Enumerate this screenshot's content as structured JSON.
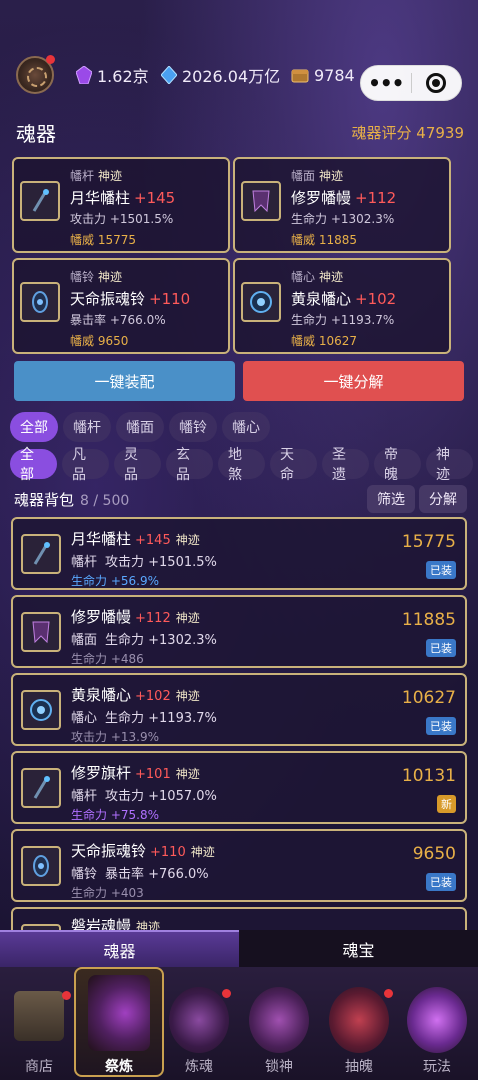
{
  "header": {
    "resources": [
      {
        "icon": "purple-crystal-icon",
        "value": "1.62京"
      },
      {
        "icon": "blue-diamond-icon",
        "value": "2026.04万亿"
      },
      {
        "icon": "gold-chest-icon",
        "value": "9784"
      }
    ]
  },
  "section": {
    "title": "魂器",
    "score_label": "魂器评分",
    "score_value": "47939"
  },
  "equipped": [
    {
      "slot": "幡杆",
      "rank": "神迹",
      "name": "月华幡柱",
      "plus": "+145",
      "stat": "攻击力 +1501.5%",
      "power": "幡威 15775",
      "icon": "staff-icon"
    },
    {
      "slot": "幡面",
      "rank": "神迹",
      "name": "修罗幡幔",
      "plus": "+112",
      "stat": "生命力 +1302.3%",
      "power": "幡威 11885",
      "icon": "banner-icon"
    },
    {
      "slot": "幡铃",
      "rank": "神迹",
      "name": "天命振魂铃",
      "plus": "+110",
      "stat": "暴击率 +766.0%",
      "power": "幡威 9650",
      "icon": "bell-icon"
    },
    {
      "slot": "幡心",
      "rank": "神迹",
      "name": "黄泉幡心",
      "plus": "+102",
      "stat": "生命力 +1193.7%",
      "power": "幡威 10627",
      "icon": "orb-icon"
    }
  ],
  "actions": {
    "equip_all": "一键装配",
    "decompose_all": "一键分解"
  },
  "filter_slots": [
    "全部",
    "幡杆",
    "幡面",
    "幡铃",
    "幡心"
  ],
  "filter_ranks": [
    "全部",
    "凡品",
    "灵品",
    "玄品",
    "地煞",
    "天命",
    "圣遗",
    "帝魄",
    "神迹"
  ],
  "bag": {
    "title": "魂器背包",
    "count": "8 / 500",
    "filter_btn": "筛选",
    "decompose_btn": "分解"
  },
  "items": [
    {
      "name": "月华幡柱",
      "plus": "+145",
      "rank": "神迹",
      "slot": "幡杆",
      "stat": "攻击力 +1501.5%",
      "sub": "生命力 +56.9%",
      "sub_color": "blue",
      "power": "15775",
      "badge": "已装",
      "badge_type": "equipped",
      "icon": "staff-icon"
    },
    {
      "name": "修罗幡幔",
      "plus": "+112",
      "rank": "神迹",
      "slot": "幡面",
      "stat": "生命力 +1302.3%",
      "sub": "生命力 +486",
      "sub_color": "gray",
      "power": "11885",
      "badge": "已装",
      "badge_type": "equipped",
      "icon": "banner-icon"
    },
    {
      "name": "黄泉幡心",
      "plus": "+102",
      "rank": "神迹",
      "slot": "幡心",
      "stat": "生命力 +1193.7%",
      "sub": "攻击力 +13.9%",
      "sub_color": "gray",
      "power": "10627",
      "badge": "已装",
      "badge_type": "equipped",
      "icon": "orb-icon"
    },
    {
      "name": "修罗旗杆",
      "plus": "+101",
      "rank": "神迹",
      "slot": "幡杆",
      "stat": "攻击力 +1057.0%",
      "sub": "生命力 +75.8%",
      "sub_color": "purple",
      "power": "10131",
      "badge": "新",
      "badge_type": "new",
      "icon": "staff-icon"
    },
    {
      "name": "天命振魂铃",
      "plus": "+110",
      "rank": "神迹",
      "slot": "幡铃",
      "stat": "暴击率 +766.0%",
      "sub": "生命力 +403",
      "sub_color": "gray",
      "power": "9650",
      "badge": "已装",
      "badge_type": "equipped",
      "icon": "bell-icon"
    },
    {
      "name": "磐岩魂幔",
      "plus": "",
      "rank": "神迹",
      "slot": "",
      "stat": "",
      "sub": "",
      "sub_color": "gray",
      "power": "",
      "badge": "",
      "badge_type": "",
      "icon": "banner-icon"
    }
  ],
  "sub_tabs": [
    "魂器",
    "魂宝"
  ],
  "nav": [
    "商店",
    "祭炼",
    "炼魂",
    "锁神",
    "抽魄",
    "玩法"
  ],
  "colors": {
    "gold": "#e8b048",
    "accent_purple": "#8a4ee0",
    "equip_blue": "#4a90c8",
    "decompose_red": "#e05050",
    "border_gold": "#c9b27a"
  }
}
